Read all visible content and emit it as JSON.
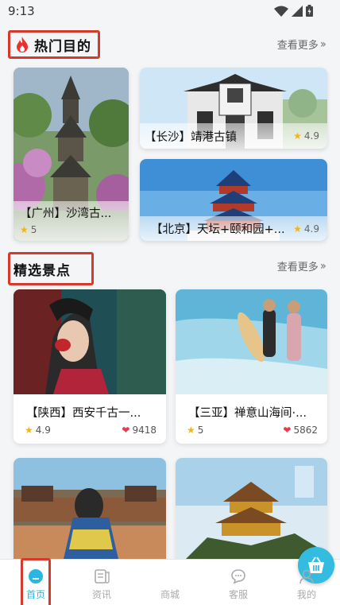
{
  "status": {
    "time": "9:13"
  },
  "hot": {
    "title": "热门目的",
    "more": "查看更多",
    "cards": [
      {
        "title": "【广州】沙湾古...",
        "rating": "5"
      },
      {
        "title": "【长沙】靖港古镇",
        "rating": "4.9"
      },
      {
        "title": "【北京】天坛+颐和园+...",
        "rating": "4.9"
      }
    ]
  },
  "spots": {
    "title": "精选景点",
    "more": "查看更多",
    "cards": [
      {
        "title": "【陕西】西安千古一...",
        "rating": "4.9",
        "likes": "9418"
      },
      {
        "title": "【三亚】禅意山海间·...",
        "rating": "5",
        "likes": "5862"
      }
    ]
  },
  "tabbar": {
    "home": "首页",
    "news": "资讯",
    "mall": "商城",
    "service": "客服",
    "mine": "我的"
  },
  "colors": {
    "accent": "#29b6e0",
    "highlight": "#d63a2c",
    "star": "#f5b31b",
    "heart": "#e23b4b"
  }
}
